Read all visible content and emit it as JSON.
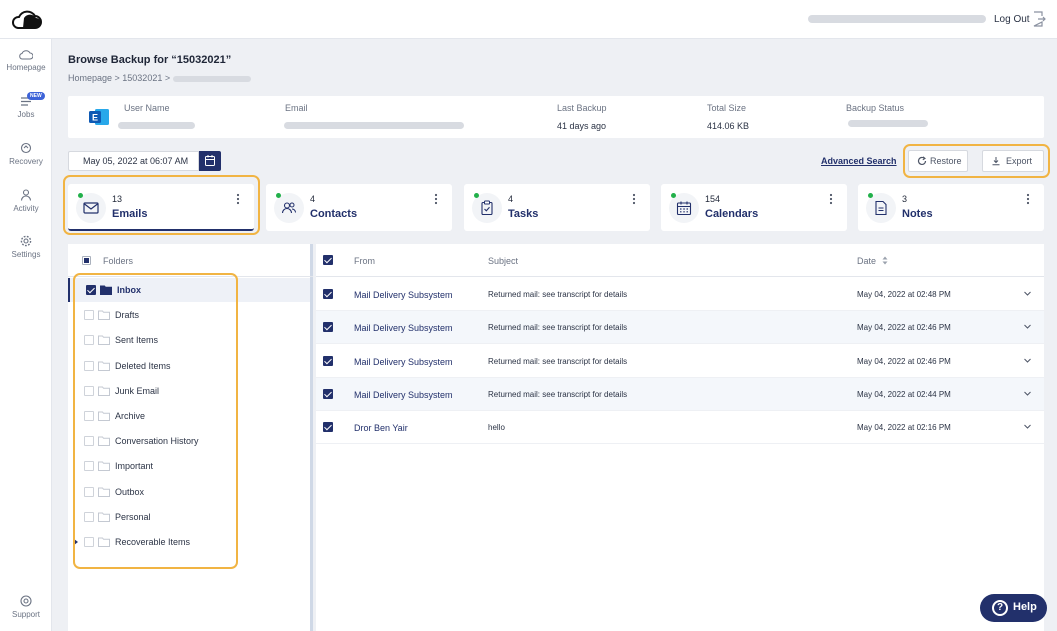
{
  "header": {
    "logout_label": "Log Out"
  },
  "sidebar": {
    "items": [
      {
        "label": "Homepage",
        "icon": "cloud-icon"
      },
      {
        "label": "Jobs",
        "icon": "jobs-icon",
        "badge": "NEW"
      },
      {
        "label": "Recovery",
        "icon": "recovery-icon"
      },
      {
        "label": "Activity",
        "icon": "person-icon"
      },
      {
        "label": "Settings",
        "icon": "gear-icon"
      }
    ],
    "support_label": "Support"
  },
  "page": {
    "title": "Browse Backup for “15032021”",
    "breadcrumb": "Homepage > 15032021 >"
  },
  "info": {
    "user_name_label": "User Name",
    "email_label": "Email",
    "last_backup_label": "Last Backup",
    "last_backup_value": "41 days ago",
    "total_size_label": "Total Size",
    "total_size_value": "414.06 KB",
    "backup_status_label": "Backup Status"
  },
  "toolbar": {
    "date_value": "May 05, 2022 at 06:07 AM",
    "advanced_search": "Advanced Search",
    "restore_label": "Restore",
    "export_label": "Export"
  },
  "tiles": [
    {
      "count": "13",
      "label": "Emails",
      "icon": "envelope-icon"
    },
    {
      "count": "4",
      "label": "Contacts",
      "icon": "contacts-icon"
    },
    {
      "count": "4",
      "label": "Tasks",
      "icon": "tasks-icon"
    },
    {
      "count": "154",
      "label": "Calendars",
      "icon": "calendar-icon"
    },
    {
      "count": "3",
      "label": "Notes",
      "icon": "notes-icon"
    }
  ],
  "folders": {
    "header": "Folders",
    "items": [
      {
        "label": "Inbox",
        "checked": true
      },
      {
        "label": "Drafts"
      },
      {
        "label": "Sent Items"
      },
      {
        "label": "Deleted Items"
      },
      {
        "label": "Junk Email"
      },
      {
        "label": "Archive"
      },
      {
        "label": "Conversation History"
      },
      {
        "label": "Important"
      },
      {
        "label": "Outbox"
      },
      {
        "label": "Personal"
      },
      {
        "label": "Recoverable Items"
      }
    ]
  },
  "mails": {
    "columns": {
      "from": "From",
      "subject": "Subject",
      "date": "Date"
    },
    "rows": [
      {
        "from": "Mail Delivery Subsystem",
        "subject": "Returned mail: see transcript for details",
        "date": "May 04, 2022 at 02:48 PM"
      },
      {
        "from": "Mail Delivery Subsystem",
        "subject": "Returned mail: see transcript for details",
        "date": "May 04, 2022 at 02:46 PM"
      },
      {
        "from": "Mail Delivery Subsystem",
        "subject": "Returned mail: see transcript for details",
        "date": "May 04, 2022 at 02:46 PM"
      },
      {
        "from": "Mail Delivery Subsystem",
        "subject": "Returned mail: see transcript for details",
        "date": "May 04, 2022 at 02:44 PM"
      },
      {
        "from": "Dror Ben Yair",
        "subject": "hello",
        "date": "May 04, 2022 at 02:16 PM"
      }
    ]
  },
  "help_label": "Help",
  "colors": {
    "primary": "#22306b",
    "highlight": "#f1b443",
    "status_dot": "#22b04a"
  }
}
